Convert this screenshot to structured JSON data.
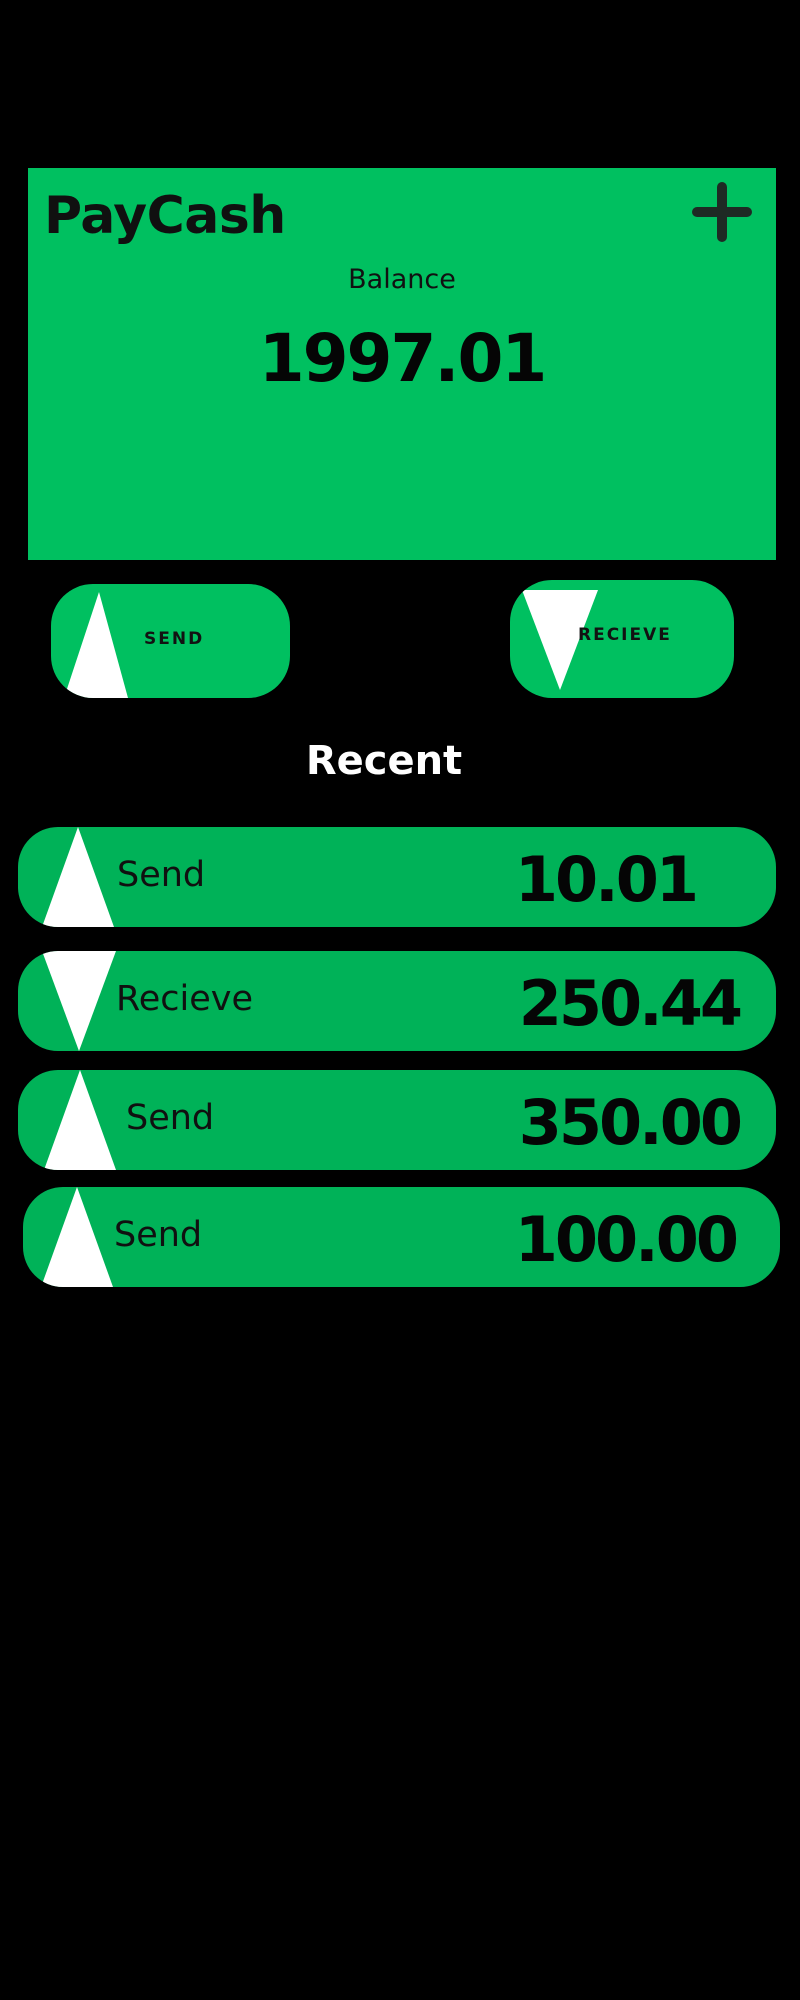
{
  "app": {
    "title": "PayCash",
    "add_icon": "plus-icon"
  },
  "balance": {
    "label": "Balance",
    "amount": "1997.01"
  },
  "actions": {
    "send_label": "SEND",
    "receive_label": "RECIEVE",
    "send_icon": "arrow-up-triangle-icon",
    "receive_icon": "arrow-down-triangle-icon"
  },
  "recent": {
    "heading": "Recent",
    "items": [
      {
        "type": "Send",
        "amount": "10.01",
        "icon": "arrow-up-triangle-icon"
      },
      {
        "type": "Recieve",
        "amount": "250.44",
        "icon": "arrow-down-triangle-icon"
      },
      {
        "type": "Send",
        "amount": "350.00",
        "icon": "arrow-up-triangle-icon"
      },
      {
        "type": "Send",
        "amount": "100.00",
        "icon": "arrow-up-triangle-icon"
      }
    ]
  },
  "colors": {
    "background": "#000000",
    "card_green": "#00c060",
    "row_green": "#00b258",
    "icon_white": "#ffffff"
  }
}
